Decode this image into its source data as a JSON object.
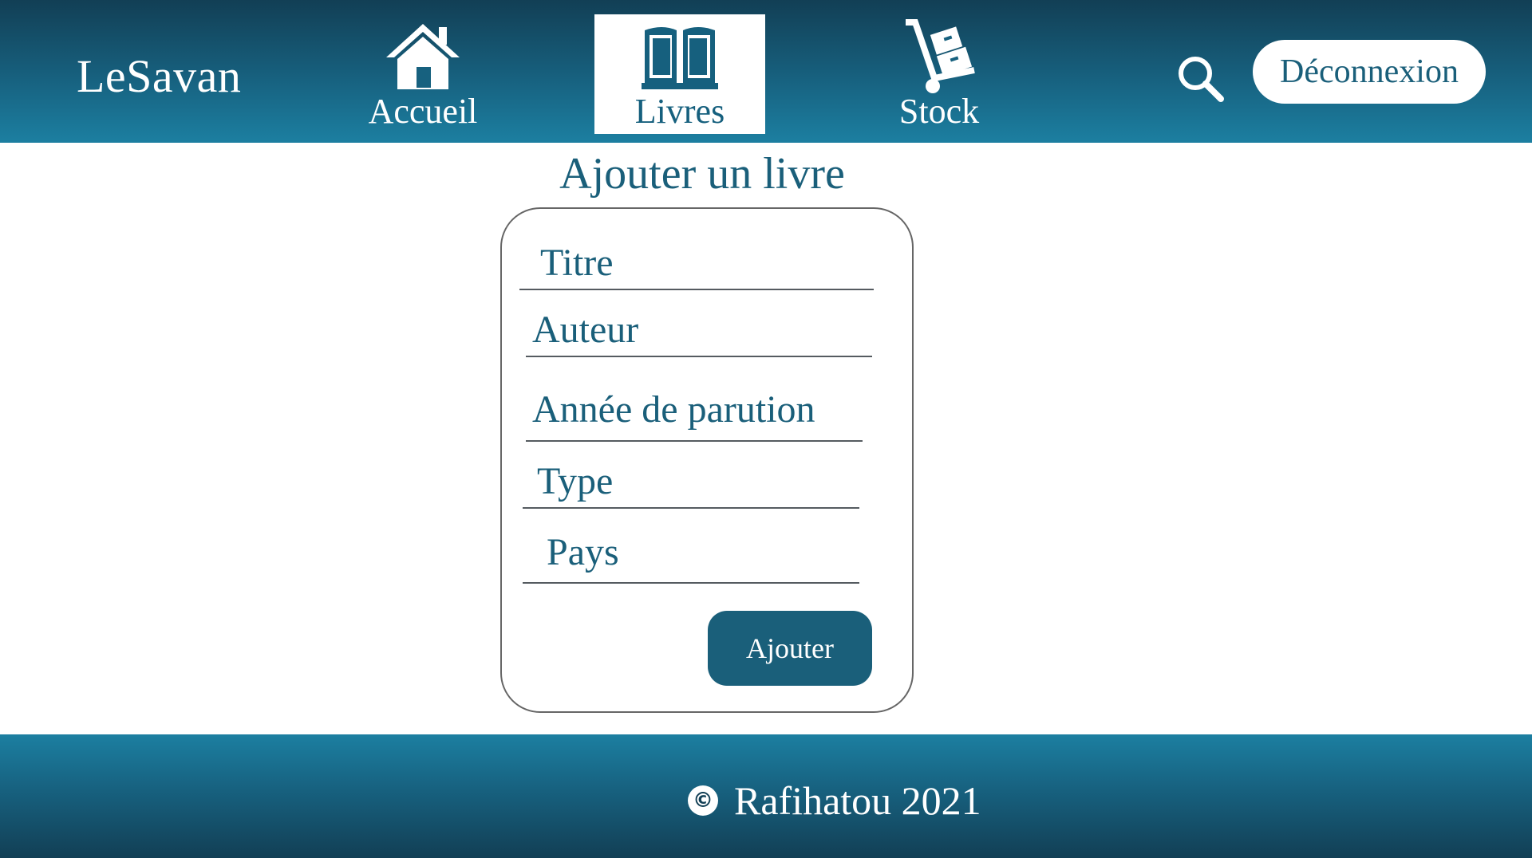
{
  "header": {
    "brand": "LeSavan",
    "nav": [
      {
        "label": "Accueil",
        "icon": "home-icon"
      },
      {
        "label": "Livres",
        "icon": "open-book-icon",
        "active": true
      },
      {
        "label": "Stock",
        "icon": "hand-truck-icon"
      }
    ],
    "search_icon": "search-icon",
    "logout_label": "Déconnexion"
  },
  "main": {
    "title": "Ajouter un livre",
    "form": {
      "fields": [
        {
          "placeholder": "Titre",
          "value": ""
        },
        {
          "placeholder": "Auteur",
          "value": ""
        },
        {
          "placeholder": "Année de parution",
          "value": ""
        },
        {
          "placeholder": "Type",
          "value": ""
        },
        {
          "placeholder": "Pays",
          "value": ""
        }
      ],
      "submit_label": "Ajouter"
    }
  },
  "footer": {
    "copyright_symbol": "©",
    "copyright_text": "Rafihatou 2021"
  },
  "colors": {
    "header_dark": "#123f55",
    "header_light": "#1c7fa1",
    "accent": "#1a5f7a",
    "text_on_dark": "#ffffff"
  }
}
